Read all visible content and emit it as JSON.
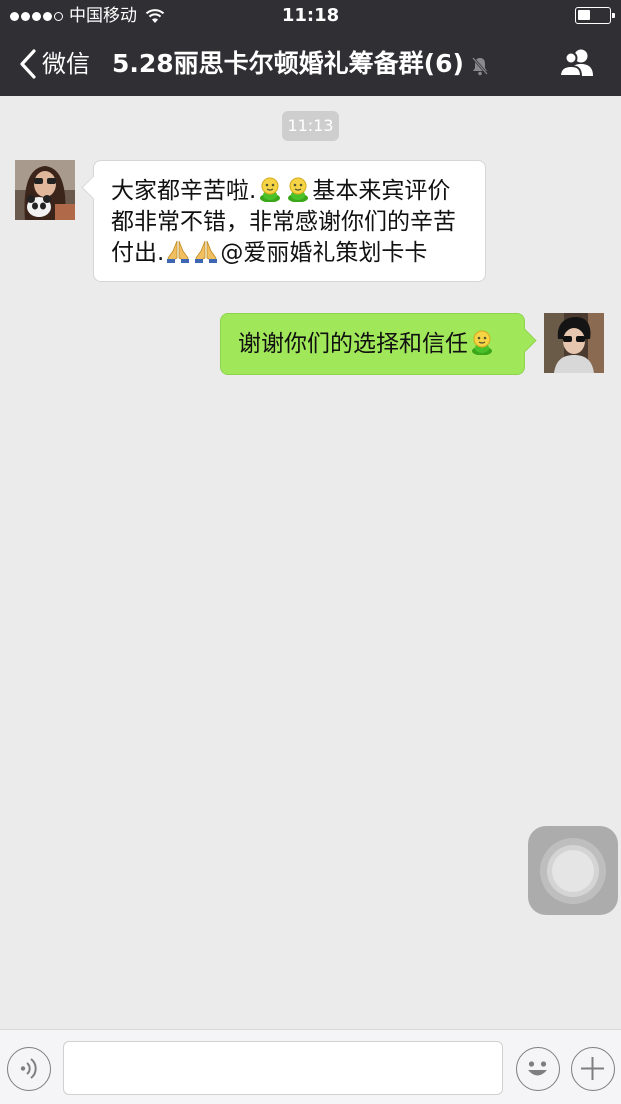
{
  "status_bar": {
    "carrier": "中国移动",
    "time": "11:18",
    "signal_icon": "signal-dots-icon",
    "wifi_icon": "wifi-icon",
    "battery_icon": "battery-icon",
    "battery_level": 0.4
  },
  "nav": {
    "back_label": "微信",
    "back_icon": "chevron-left-icon",
    "title": "5.28丽思卡尔顿婚礼筹备群(6)",
    "mute_icon": "bell-muted-icon",
    "members_icon": "group-members-icon"
  },
  "chat": {
    "timestamp": "11:13",
    "messages": [
      {
        "direction": "incoming",
        "avatar_icon": "avatar-woman-with-panda",
        "lines": [
          [
            "大家都辛苦啦.",
            "[emoji:green-smiley]",
            "[emoji:green-smiley]",
            "基本来宾评价"
          ],
          [
            "都非常不错，非常感谢你们的辛苦"
          ],
          [
            "付出.",
            "[emoji:praying-hands]",
            "[emoji:praying-hands]",
            "@爱丽婚礼策划卡卡"
          ]
        ],
        "text_parts": {
          "l1a": "大家都辛苦啦.",
          "l1b": "基本来宾评价",
          "l2": "都非常不错，非常感谢你们的辛苦",
          "l3a": "付出.",
          "l3b": "@爱丽婚礼策划卡卡"
        }
      },
      {
        "direction": "outgoing",
        "avatar_icon": "avatar-person-sunglasses",
        "text_parts": {
          "l1a": "谢谢你们的选择和信任"
        }
      }
    ]
  },
  "input_bar": {
    "voice_icon": "voice-icon",
    "emoji_icon": "emoji-icon",
    "plus_icon": "plus-icon",
    "text_value": ""
  },
  "overlay": {
    "assistive_touch_icon": "assistive-touch-icon"
  },
  "colors": {
    "header_bg": "#2f2f34",
    "chat_bg": "#ebebeb",
    "outgoing_bubble": "#a0e75a",
    "incoming_bubble": "#ffffff"
  }
}
